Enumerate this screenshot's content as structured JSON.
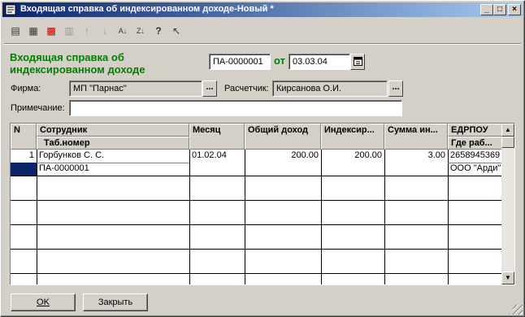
{
  "window": {
    "title": "Входящая справка об индексированном доходе-Новый *"
  },
  "header": {
    "doc_title": "Входящая справка об индексированном доходе",
    "number": "ПА-0000001",
    "from_label": "от",
    "date": "03.03.04"
  },
  "form": {
    "firm_label": "Фирма:",
    "firm_value": "МП \"Парнас\"",
    "calc_label": "Расчетчик:",
    "calc_value": "Кирсанова О.И.",
    "note_label": "Примечание:",
    "note_value": ""
  },
  "grid": {
    "headers": {
      "n": "N",
      "employee": "Сотрудник",
      "tab_number": "Таб.номер",
      "month": "Месяц",
      "total_income": "Общий доход",
      "indexed": "Индексир...",
      "sum_index": "Сумма ин...",
      "edrpou": "ЕДРПОУ",
      "where_work": "Где раб..."
    },
    "rows": [
      {
        "n": "1",
        "employee": "Горбунков С. С.",
        "tab_number": "ПА-0000001",
        "month": "01.02.04",
        "total_income": "200.00",
        "indexed": "200.00",
        "sum_index": "3.00",
        "edrpou": "2658945369",
        "where_work": "ООО \"Арди\""
      }
    ]
  },
  "buttons": {
    "ok": "OK",
    "close": "Закрыть"
  }
}
